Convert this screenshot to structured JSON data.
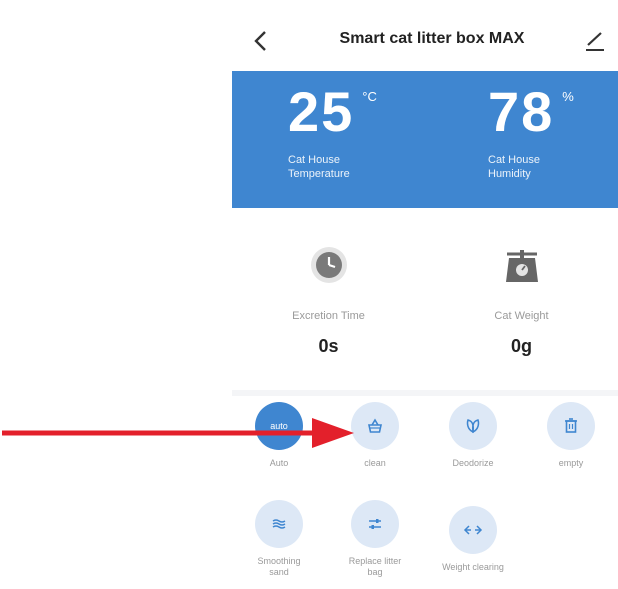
{
  "header": {
    "title": "Smart cat litter box MAX",
    "back_icon": "chevron-left-icon",
    "edit_icon": "pencil-icon"
  },
  "climate": {
    "temperature": {
      "value": "25",
      "unit": "°C",
      "label_line1": "Cat House",
      "label_line2": "Temperature"
    },
    "humidity": {
      "value": "78",
      "unit": "%",
      "label_line1": "Cat House",
      "label_line2": "Humidity"
    }
  },
  "stats": {
    "excretion": {
      "label": "Excretion Time",
      "value": "0s",
      "icon": "clock-icon"
    },
    "weight": {
      "label": "Cat Weight",
      "value": "0g",
      "icon": "scale-icon"
    }
  },
  "actions": [
    {
      "label": "Auto",
      "badge": "auto",
      "icon": "auto-icon",
      "active": true
    },
    {
      "label": "clean",
      "icon": "basket-icon",
      "active": false
    },
    {
      "label": "Deodorize",
      "icon": "leaf-icon",
      "active": false
    },
    {
      "label": "empty",
      "icon": "trash-icon",
      "active": false
    },
    {
      "label_line1": "Smoothing",
      "label_line2": "sand",
      "icon": "waves-icon",
      "active": false
    },
    {
      "label_line1": "Replace litter",
      "label_line2": "bag",
      "icon": "sliders-icon",
      "active": false
    },
    {
      "label": "Weight clearing",
      "icon": "arrows-horizontal-icon",
      "active": false
    }
  ],
  "colors": {
    "accent": "#3f86d0",
    "action_bg": "#dde8f6",
    "annotation_arrow": "#e3202b"
  }
}
